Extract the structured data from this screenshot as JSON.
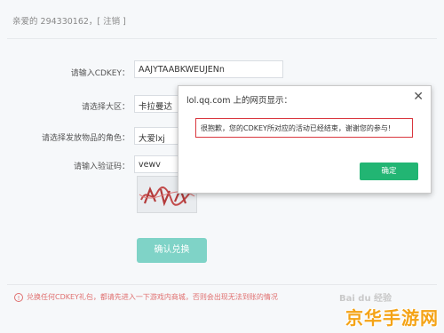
{
  "header": {
    "greeting": "亲爱的 294330162，",
    "logout_label": "[ 注销 ]"
  },
  "form": {
    "cdkey_label": "请输入CDKEY：",
    "cdkey_value": "AAJYTAABKWEUJENn",
    "region_label": "请选择大区：",
    "region_value": "卡拉曼达",
    "role_label": "请选择发放物品的角色：",
    "role_value": "大爱lxj",
    "captcha_label": "请输入验证码：",
    "captcha_value": "vewv",
    "confirm_label": "确认兑换"
  },
  "notice": {
    "text": "兑换任何CDKEY礼包，都请先进入一下游戏内商城，否则会出现无法到账的情况"
  },
  "dialog": {
    "title": "lol.qq.com 上的网页显示：",
    "message": "很抱歉，您的CDKEY所对应的活动已经结束，谢谢您的参与!",
    "ok_label": "确定",
    "close_glyph": "✕"
  },
  "watermarks": {
    "baidu": "Bai du 经验",
    "brand": "京华手游网"
  },
  "colors": {
    "confirm_button": "#7fd3c7",
    "dialog_ok": "#22b573",
    "highlight_border": "#d9363e",
    "notice_text": "#e06f6f",
    "brand": "#f4a316"
  }
}
